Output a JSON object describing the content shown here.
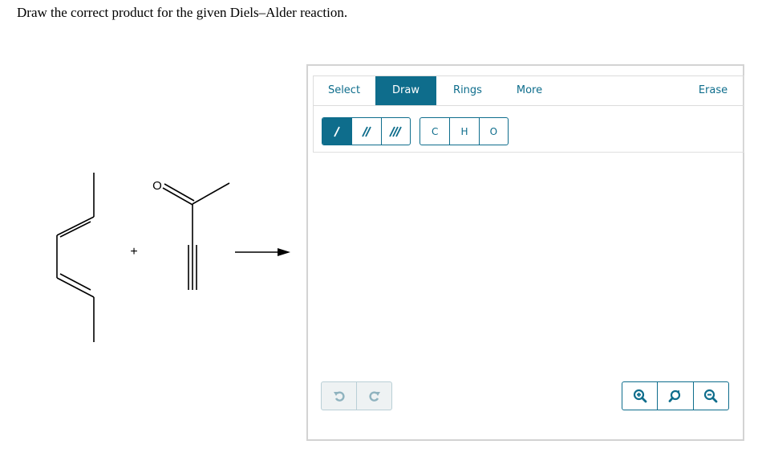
{
  "question": "Draw the correct product for the given Diels–Alder reaction.",
  "reaction": {
    "diene": "2,4-hexadiene (line structure)",
    "plus_sign": "+",
    "dienophile_atom_label": "O",
    "arrow": "reaction-arrow"
  },
  "editor": {
    "tabs": [
      {
        "label": "Select",
        "active": false
      },
      {
        "label": "Draw",
        "active": true
      },
      {
        "label": "Rings",
        "active": false
      },
      {
        "label": "More",
        "active": false
      }
    ],
    "erase_label": "Erase",
    "bond_tools": [
      {
        "name": "single-bond",
        "active": true
      },
      {
        "name": "double-bond",
        "active": false
      },
      {
        "name": "triple-bond",
        "active": false
      }
    ],
    "atom_tools": [
      "C",
      "H",
      "O"
    ],
    "history": [
      "undo-icon",
      "redo-icon"
    ],
    "zoom": [
      "zoom-in-icon",
      "zoom-reset-icon",
      "zoom-out-icon"
    ]
  },
  "colors": {
    "accent": "#0e6d8c",
    "panel_border": "#d3d3d3",
    "history_bg": "#eef2f3"
  }
}
